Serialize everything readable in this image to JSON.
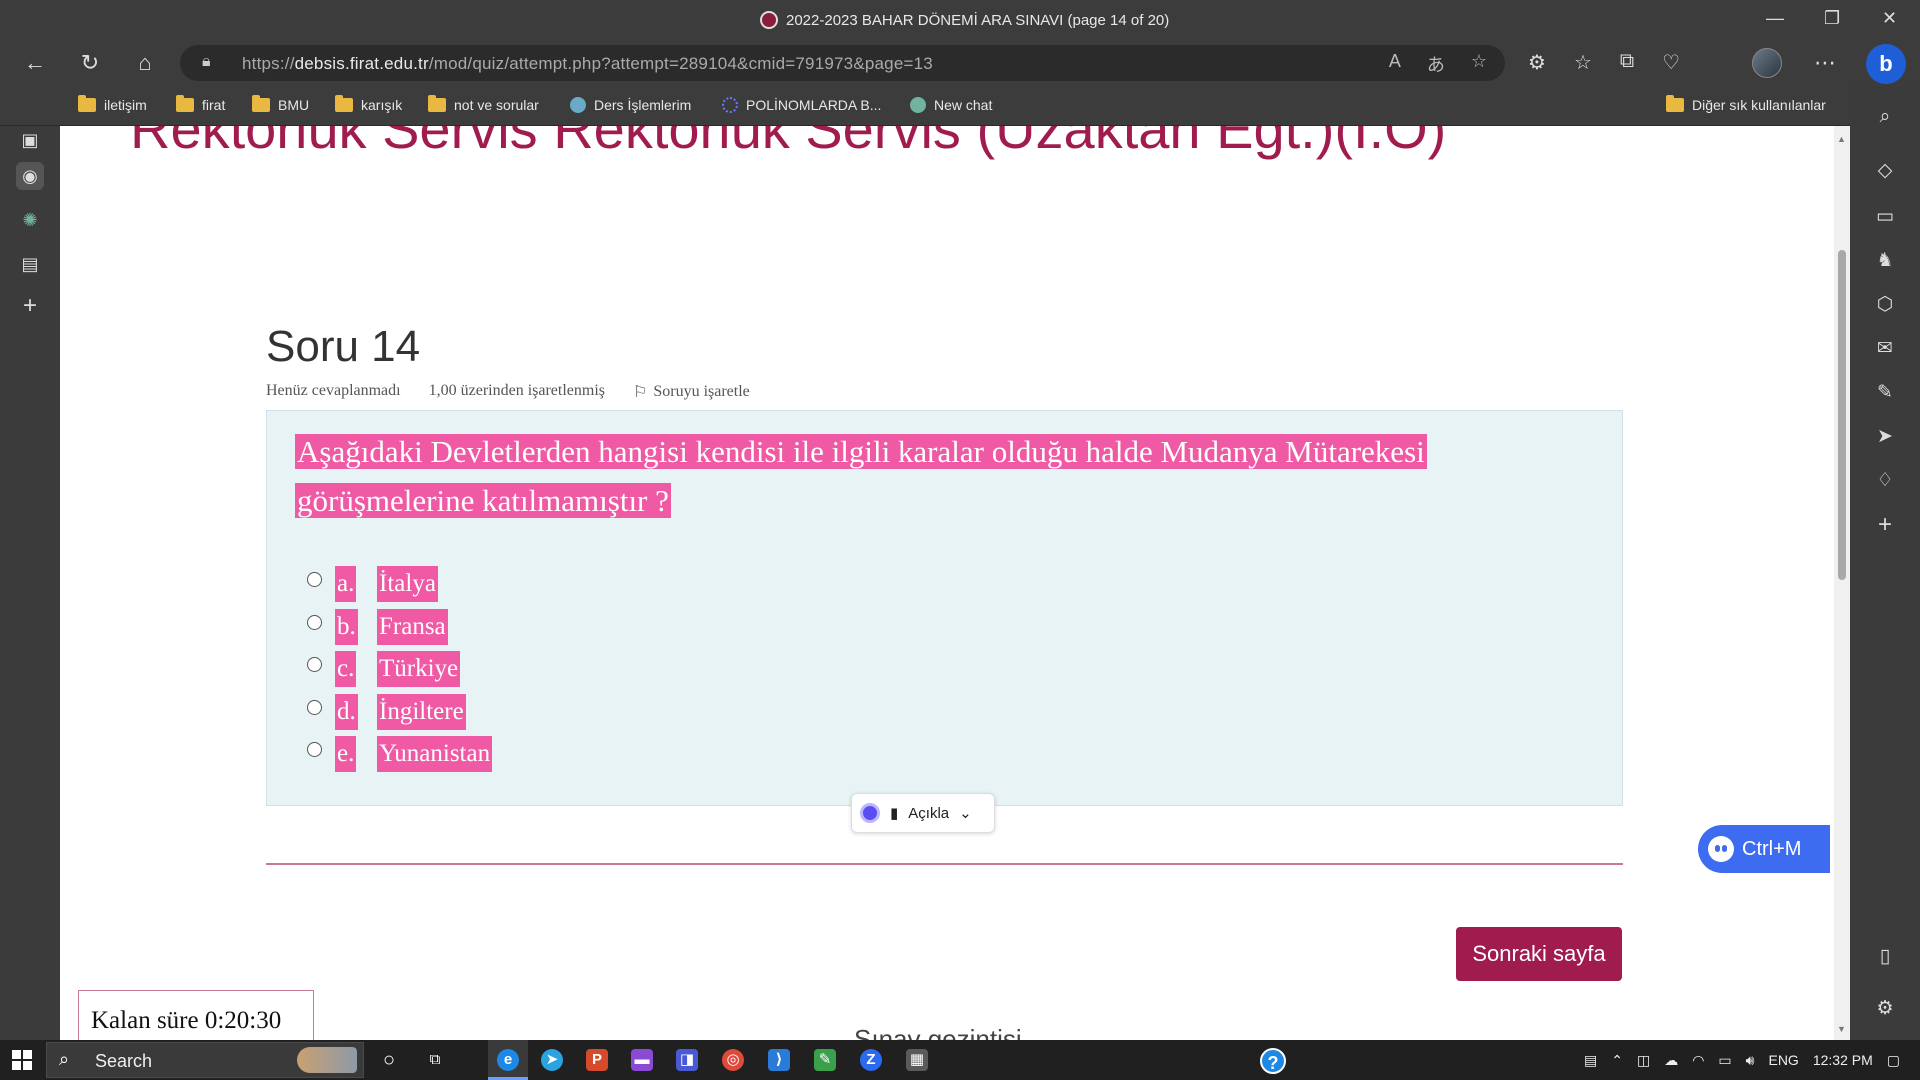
{
  "window": {
    "title": "2022-2023 BAHAR DÖNEMİ ARA SINAVI (page 14 of 20)"
  },
  "address_bar": {
    "url_prefix": "https://",
    "url_domain": "debsis.firat.edu.tr",
    "url_path": "/mod/quiz/attempt.php?attempt=289104&cmid=791973&page=13"
  },
  "bookmarks": {
    "items": [
      "iletişim",
      "firat",
      "BMU",
      "karışık",
      "not ve sorular",
      "Ders İşlemlerim",
      "POLİNOMLARDA B...",
      "New chat"
    ],
    "other": "Diğer sık kullanılanlar"
  },
  "page": {
    "course_title": "Rektörlük Servis Rektörlük Servis (Uzaktan Egt.)(I.Ö)",
    "question_title": "Soru 14",
    "status": "Henüz cevaplanmadı",
    "grade": "1,00 üzerinden işaretlenmiş",
    "flag_label": "Soruyu işaretle",
    "question_line1": "Aşağıdaki Devletlerden hangisi kendisi ile ilgili karalar olduğu halde Mudanya Mütarekesi",
    "question_line2": "görüşmelerine katılmamıştır ?",
    "options": [
      {
        "letter": "a.",
        "text": "İtalya"
      },
      {
        "letter": "b.",
        "text": "Fransa"
      },
      {
        "letter": "c.",
        "text": "Türkiye"
      },
      {
        "letter": "d.",
        "text": "İngiltere"
      },
      {
        "letter": "e.",
        "text": "Yunanistan"
      }
    ],
    "explain_label": "Açıkla",
    "next_button": "Sonraki sayfa",
    "timer": "Kalan süre 0:20:30",
    "nav_hint": "Sınav gezintisi",
    "ai_shortcut": "Ctrl+M"
  },
  "taskbar": {
    "search_placeholder": "Search",
    "language": "ENG",
    "time": "12:32 PM"
  },
  "colors": {
    "brand": "#a01c4e",
    "highlight": "#f05aa5",
    "question_bg": "#e7f3f5",
    "browser_chrome": "#3c3c3c"
  }
}
